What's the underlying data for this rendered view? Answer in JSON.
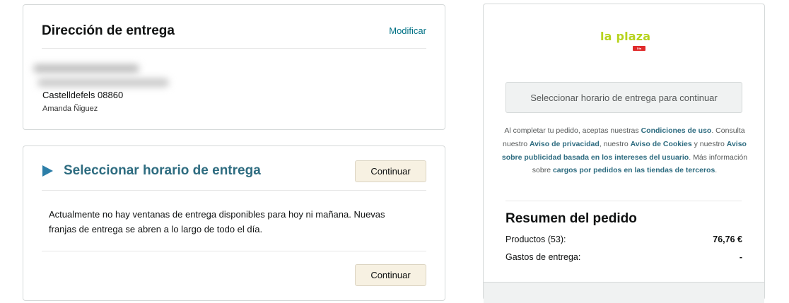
{
  "address": {
    "title": "Dirección de entrega",
    "modify_label": "Modificar",
    "city_line": "Castelldefels 08860",
    "name_line": "Amanda Ñiguez"
  },
  "slot": {
    "title": "Seleccionar horario de entrega",
    "continue_label": "Continuar",
    "message": "Actualmente no hay ventanas de entrega disponibles para hoy ni mañana. Nuevas franjas de entrega se abren a lo largo de todo el día."
  },
  "summary": {
    "logo_text": "la plaza",
    "logo_badge": "Dia",
    "select_button_label": "Seleccionar horario de entrega para continuar",
    "legal": {
      "t1": "Al completar tu pedido, aceptas nuestras ",
      "l1": "Condiciones de uso",
      "t2": ". Consulta nuestro ",
      "l2": "Aviso de privacidad",
      "t3": ", nuestro ",
      "l3": "Aviso de Cookies",
      "t4": " y nuestro ",
      "l4": "Aviso sobre publicidad basada en los intereses del usuario",
      "t5": ". Más información sobre ",
      "l5": "cargos por pedidos en las tiendas de terceros",
      "t6": "."
    },
    "title": "Resumen del pedido",
    "products_label": "Productos (53):",
    "products_value": "76,76 €",
    "shipping_label": "Gastos de entrega:",
    "shipping_value": "-"
  },
  "colors": {
    "link": "#007185",
    "section_title": "#2e6c80",
    "arrow": "#2c7ea8",
    "logo": "#b7d31e",
    "continue_bg": "#f7f1e2"
  }
}
